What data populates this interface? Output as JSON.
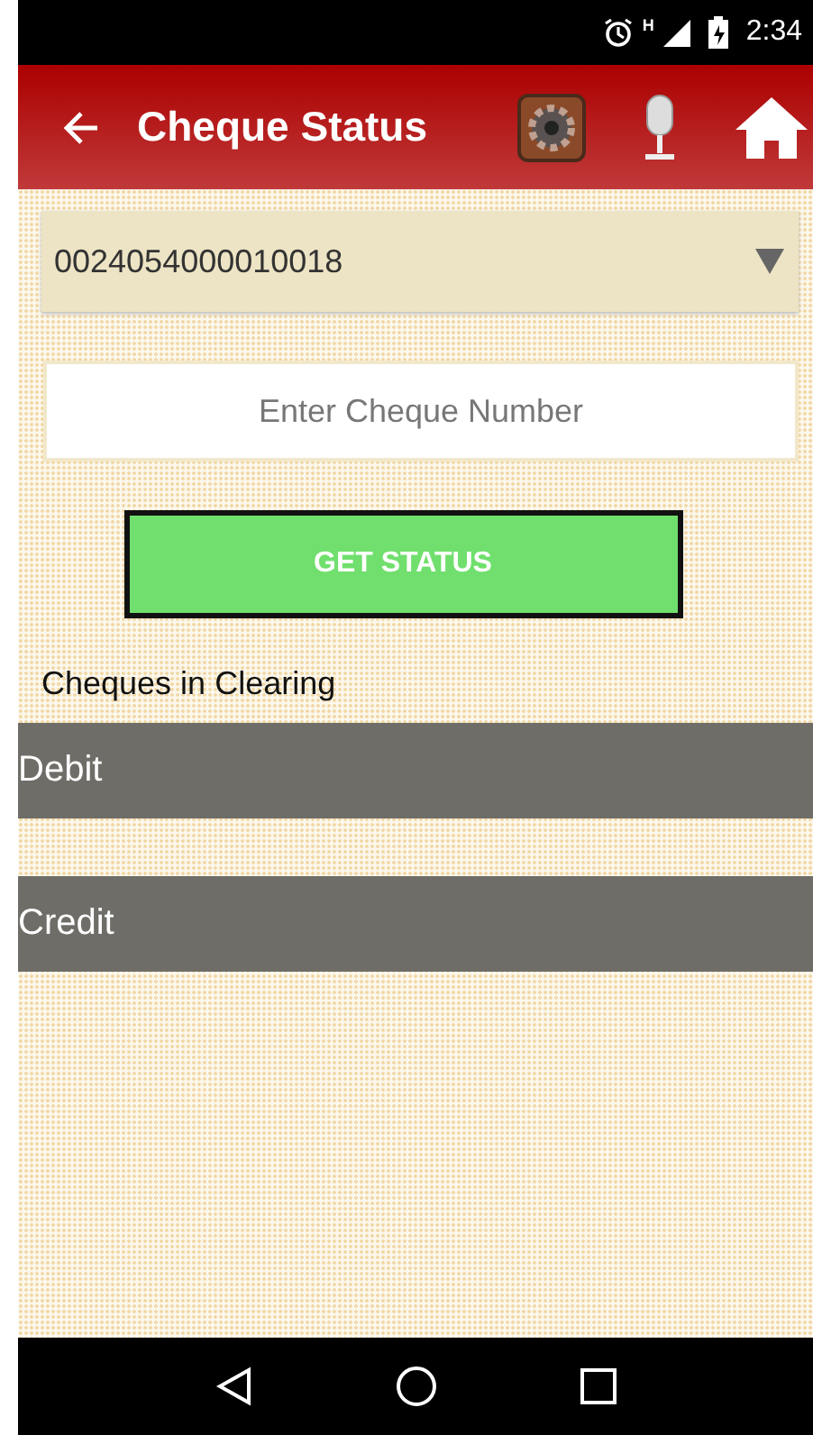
{
  "status_bar": {
    "time": "2:34",
    "network": "H"
  },
  "app_bar": {
    "title": "Cheque Status"
  },
  "account_dropdown": {
    "value": "0024054000010018"
  },
  "cheque_field": {
    "placeholder": "Enter Cheque Number"
  },
  "get_status_button": {
    "label": "GET STATUS"
  },
  "section_title": "Cheques in Clearing",
  "clearing_sections": [
    {
      "label": "Debit"
    },
    {
      "label": "Credit"
    }
  ]
}
